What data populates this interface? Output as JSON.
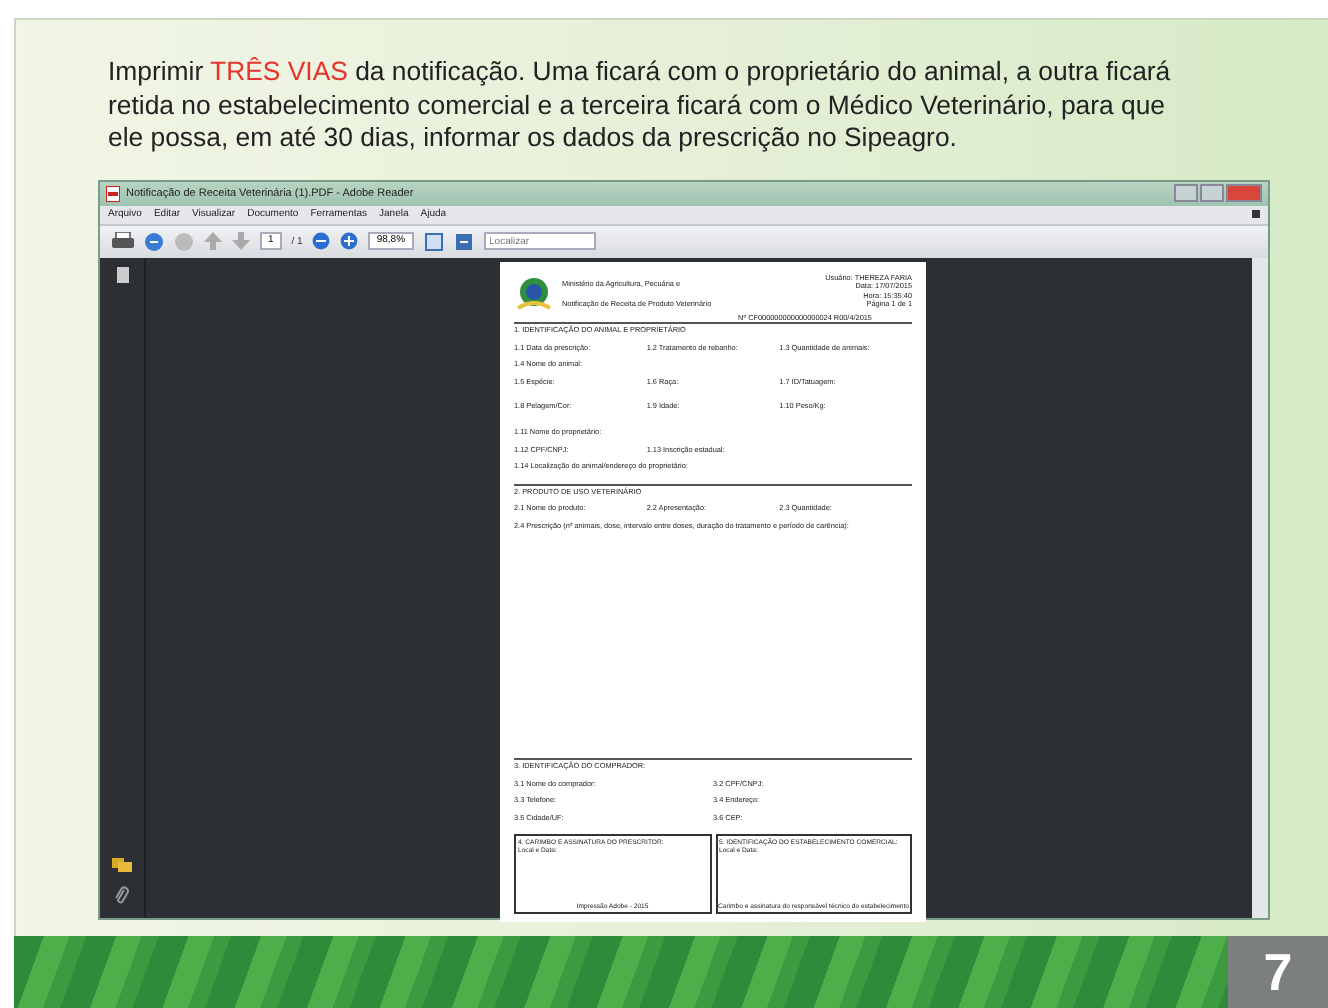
{
  "slide": {
    "intro": {
      "before": "Imprimir ",
      "highlight": "TRÊS VIAS",
      "after": " da notificação. Uma ficará com o proprietário do animal, a outra ficará retida no estabelecimento comercial e a terceira ficará com o Médico Veterinário, para que ele possa, em até 30 dias, informar os dados da prescrição no Sipeagro."
    },
    "page_number": "7"
  },
  "window": {
    "title": "Notificação de Receita Veterinária (1).PDF - Adobe Reader",
    "menu": [
      "Arquivo",
      "Editar",
      "Visualizar",
      "Documento",
      "Ferramentas",
      "Janela",
      "Ajuda"
    ],
    "toolbar": {
      "page": "1",
      "page_total": "/ 1",
      "zoom": "98,8%",
      "find_placeholder": "Localizar"
    },
    "document": {
      "agency": "Ministério da Agricultura, Pecuária e",
      "doc_title": "Notificação de Receita de Produto Veterinário",
      "meta": [
        "Usuário: THEREZA FARIA",
        "Data: 17/07/2015",
        "Hora: 15:35:40",
        "Página 1 de 1"
      ],
      "number": "Nº CF000000000000000024 R00/4/2015",
      "sections": [
        {
          "heading": "1. IDENTIFICAÇÃO DO ANIMAL E PROPRIETÁRIO",
          "rows": [
            [
              "1.1 Data da prescrição:",
              "1.2 Tratamento de rebanho:",
              "1.3 Quantidade de animais:"
            ],
            [
              "1.4 Nome do animal:"
            ],
            [
              "1.5 Espécie:",
              "1.6 Raça:",
              "1.7 ID/Tatuagem:"
            ],
            [
              "1.8 Pelagem/Cor:",
              "1.9 Idade:",
              "1.10 Peso/Kg:"
            ],
            [
              "1.11 Nome do proprietário:"
            ],
            [
              "1.12 CPF/CNPJ:",
              "1.13 Inscrição estadual:"
            ],
            [
              "1.14 Localização do animal/endereço do proprietário:"
            ]
          ]
        },
        {
          "heading": "2. PRODUTO DE USO VETERINÁRIO",
          "rows": [
            [
              "2.1 Nome do produto:",
              "2.2 Apresentação:",
              "2.3 Quantidade:"
            ],
            [
              "2.4 Prescrição (nº animais, dose, intervalo entre doses, duração do tratamento e período de carência):"
            ]
          ]
        },
        {
          "heading": "3. IDENTIFICAÇÃO DO COMPRADOR:",
          "rows": [
            [
              "3.1 Nome do comprador:",
              "3.2 CPF/CNPJ:"
            ],
            [
              "3.3 Telefone:",
              "3.4 Endereço:"
            ],
            [
              "3.5 Cidade/UF:",
              "3.6 CEP:"
            ]
          ]
        }
      ],
      "boxes": [
        {
          "heading": "4. CARIMBO E ASSINATURA DO PRESCRITOR:",
          "line": "Local e Data:",
          "footer": "Impressão Adobe - 2015"
        },
        {
          "heading": "5. IDENTIFICAÇÃO DO ESTABELECIMENTO COMERCIAL:",
          "line": "Local e Data:",
          "footer": "Carimbo e assinatura do responsável técnico do estabelecimento"
        }
      ]
    }
  }
}
